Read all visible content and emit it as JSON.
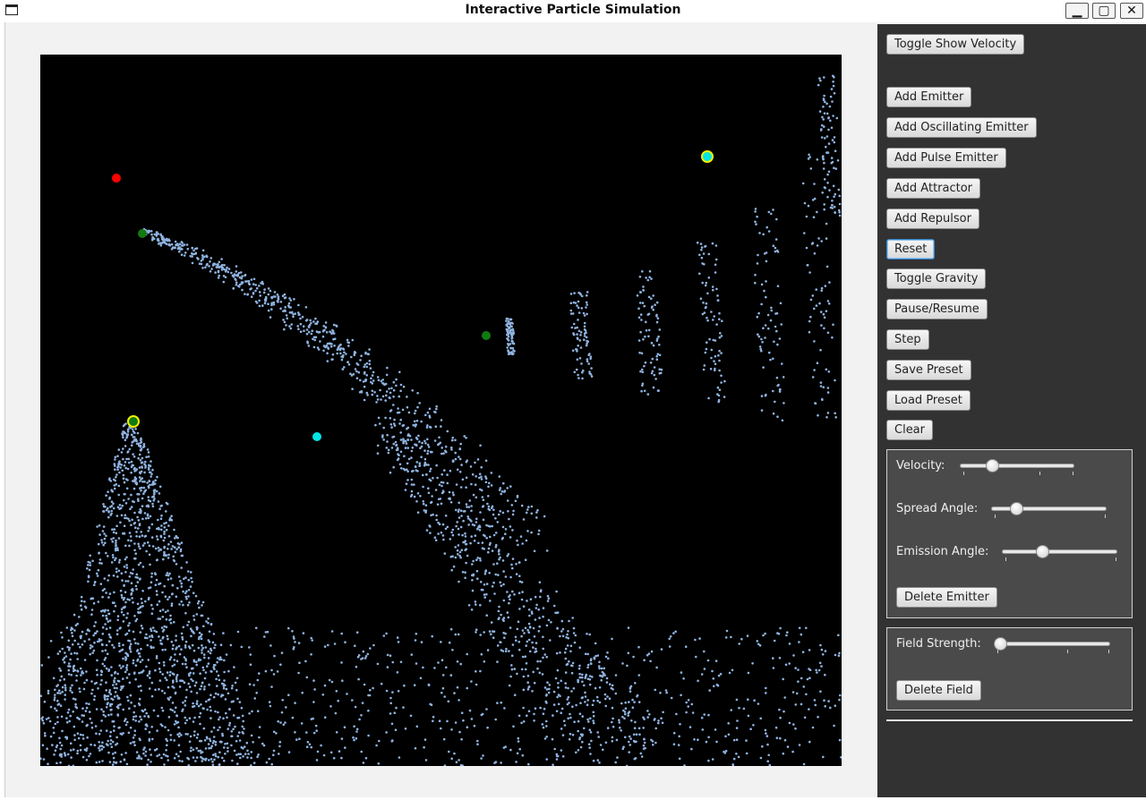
{
  "window": {
    "title": "Interactive Particle Simulation",
    "minimize_glyph": "▁",
    "maximize_glyph": "▢",
    "close_glyph": "✕"
  },
  "toolbar": {
    "buttons": [
      {
        "key": "toggle-show-velocity",
        "label": "Toggle Show Velocity"
      },
      {
        "key": "add-emitter",
        "label": "Add Emitter"
      },
      {
        "key": "add-oscillating-emitter",
        "label": "Add Oscillating Emitter"
      },
      {
        "key": "add-pulse-emitter",
        "label": "Add Pulse Emitter"
      },
      {
        "key": "add-attractor",
        "label": "Add Attractor"
      },
      {
        "key": "add-repulsor",
        "label": "Add Repulsor"
      },
      {
        "key": "reset",
        "label": "Reset"
      },
      {
        "key": "toggle-gravity",
        "label": "Toggle Gravity"
      },
      {
        "key": "pause-resume",
        "label": "Pause/Resume"
      },
      {
        "key": "step",
        "label": "Step"
      },
      {
        "key": "save-preset",
        "label": "Save Preset"
      },
      {
        "key": "load-preset",
        "label": "Load Preset"
      },
      {
        "key": "clear",
        "label": "Clear"
      }
    ]
  },
  "emitter_panel": {
    "velocity_label": "Velocity:",
    "velocity_value": 0.25,
    "spread_label": "Spread Angle:",
    "spread_value": 0.18,
    "emission_label": "Emission Angle:",
    "emission_value": 0.33,
    "delete_label": "Delete Emitter"
  },
  "field_panel": {
    "strength_label": "Field Strength:",
    "strength_value": 0.0,
    "delete_label": "Delete Field"
  },
  "colors": {
    "particle": "#8fb3e0",
    "emitter": "#117a11",
    "attractor": "#00e5e5",
    "repulsor": "#ff0000",
    "selected_ring": "#f0f000",
    "canvas_bg": "#000000",
    "panel_bg": "#323232"
  }
}
